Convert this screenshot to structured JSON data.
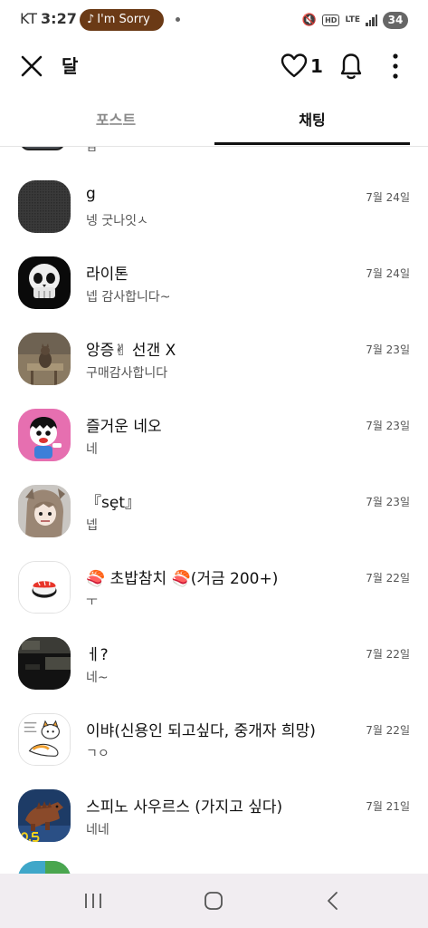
{
  "status_bar": {
    "carrier": "KT",
    "time": "3:27",
    "now_playing": "I'm Sorry",
    "network": "LTE",
    "hd": "HD",
    "battery": "34"
  },
  "header": {
    "title": "달",
    "like_count": "1"
  },
  "tabs": [
    {
      "label": "포스트",
      "selected": false
    },
    {
      "label": "채팅",
      "selected": true
    }
  ],
  "chats": [
    {
      "name": "g",
      "preview": "넹 굿나잇ㅅ",
      "date": "7월 24일",
      "avatar": "dark-fabric"
    },
    {
      "name": "라이톤",
      "preview": "넵 감사합니다~",
      "date": "7월 24일",
      "avatar": "skull"
    },
    {
      "name": "앙증✌ 선갠 X",
      "preview": "구매감사합니다",
      "date": "7월 23일",
      "avatar": "cat-photo"
    },
    {
      "name": "즐거운 네오",
      "preview": "네",
      "date": "7월 23일",
      "avatar": "neo-character"
    },
    {
      "name": "『sȩt』",
      "preview": "넵",
      "date": "7월 23일",
      "avatar": "anime-girl"
    },
    {
      "name": "🍣 초밥참치 🍣(거금 200+)",
      "preview": "ㅜ",
      "date": "7월 22일",
      "avatar": "sushi"
    },
    {
      "name": "ㅔ?",
      "preview": "네~",
      "date": "7월 22일",
      "avatar": "dark-photo"
    },
    {
      "name": "이뱌(신용인 되고싶다, 중개자 희망)",
      "preview": "ㄱㅇ",
      "date": "7월 22일",
      "avatar": "cat-drawing"
    },
    {
      "name": "스피노 사우르스 (가지고 싶다)",
      "preview": "네네",
      "date": "7월 21일",
      "avatar": "dinosaur"
    }
  ],
  "colors": {
    "now_playing_pill": "#6b3a16",
    "active_tab": "#111111",
    "inactive_tab": "#8a8a8a",
    "nav_bar": "#f1edf1"
  }
}
